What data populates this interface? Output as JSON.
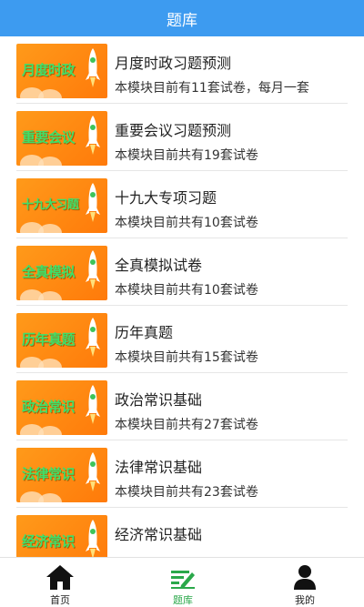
{
  "header": {
    "title": "题库"
  },
  "items": [
    {
      "thumb_text": "月度时政",
      "title": "月度时政习题预测",
      "desc": "本模块目前有11套试卷，每月一套"
    },
    {
      "thumb_text": "重要会议",
      "title": "重要会议习题预测",
      "desc": "本模块目前共有19套试卷"
    },
    {
      "thumb_text": "十九大习题",
      "title": "十九大专项习题",
      "desc": "本模块目前共有10套试卷"
    },
    {
      "thumb_text": "全真模拟",
      "title": "全真模拟试卷",
      "desc": "本模块目前共有10套试卷"
    },
    {
      "thumb_text": "历年真题",
      "title": "历年真题",
      "desc": "本模块目前共有15套试卷"
    },
    {
      "thumb_text": "政治常识",
      "title": "政治常识基础",
      "desc": "本模块目前共有27套试卷"
    },
    {
      "thumb_text": "法律常识",
      "title": "法律常识基础",
      "desc": "本模块目前共有23套试卷"
    },
    {
      "thumb_text": "经济常识",
      "title": "经济常识基础",
      "desc": ""
    }
  ],
  "tabbar": {
    "tabs": [
      {
        "label": "首页",
        "icon": "home-icon",
        "active": false
      },
      {
        "label": "题库",
        "icon": "question-bank-icon",
        "active": true
      },
      {
        "label": "我的",
        "icon": "profile-icon",
        "active": false
      }
    ]
  },
  "colors": {
    "header": "#3d9bf0",
    "accent": "#2aa84a",
    "thumb": "#ff8a12"
  }
}
